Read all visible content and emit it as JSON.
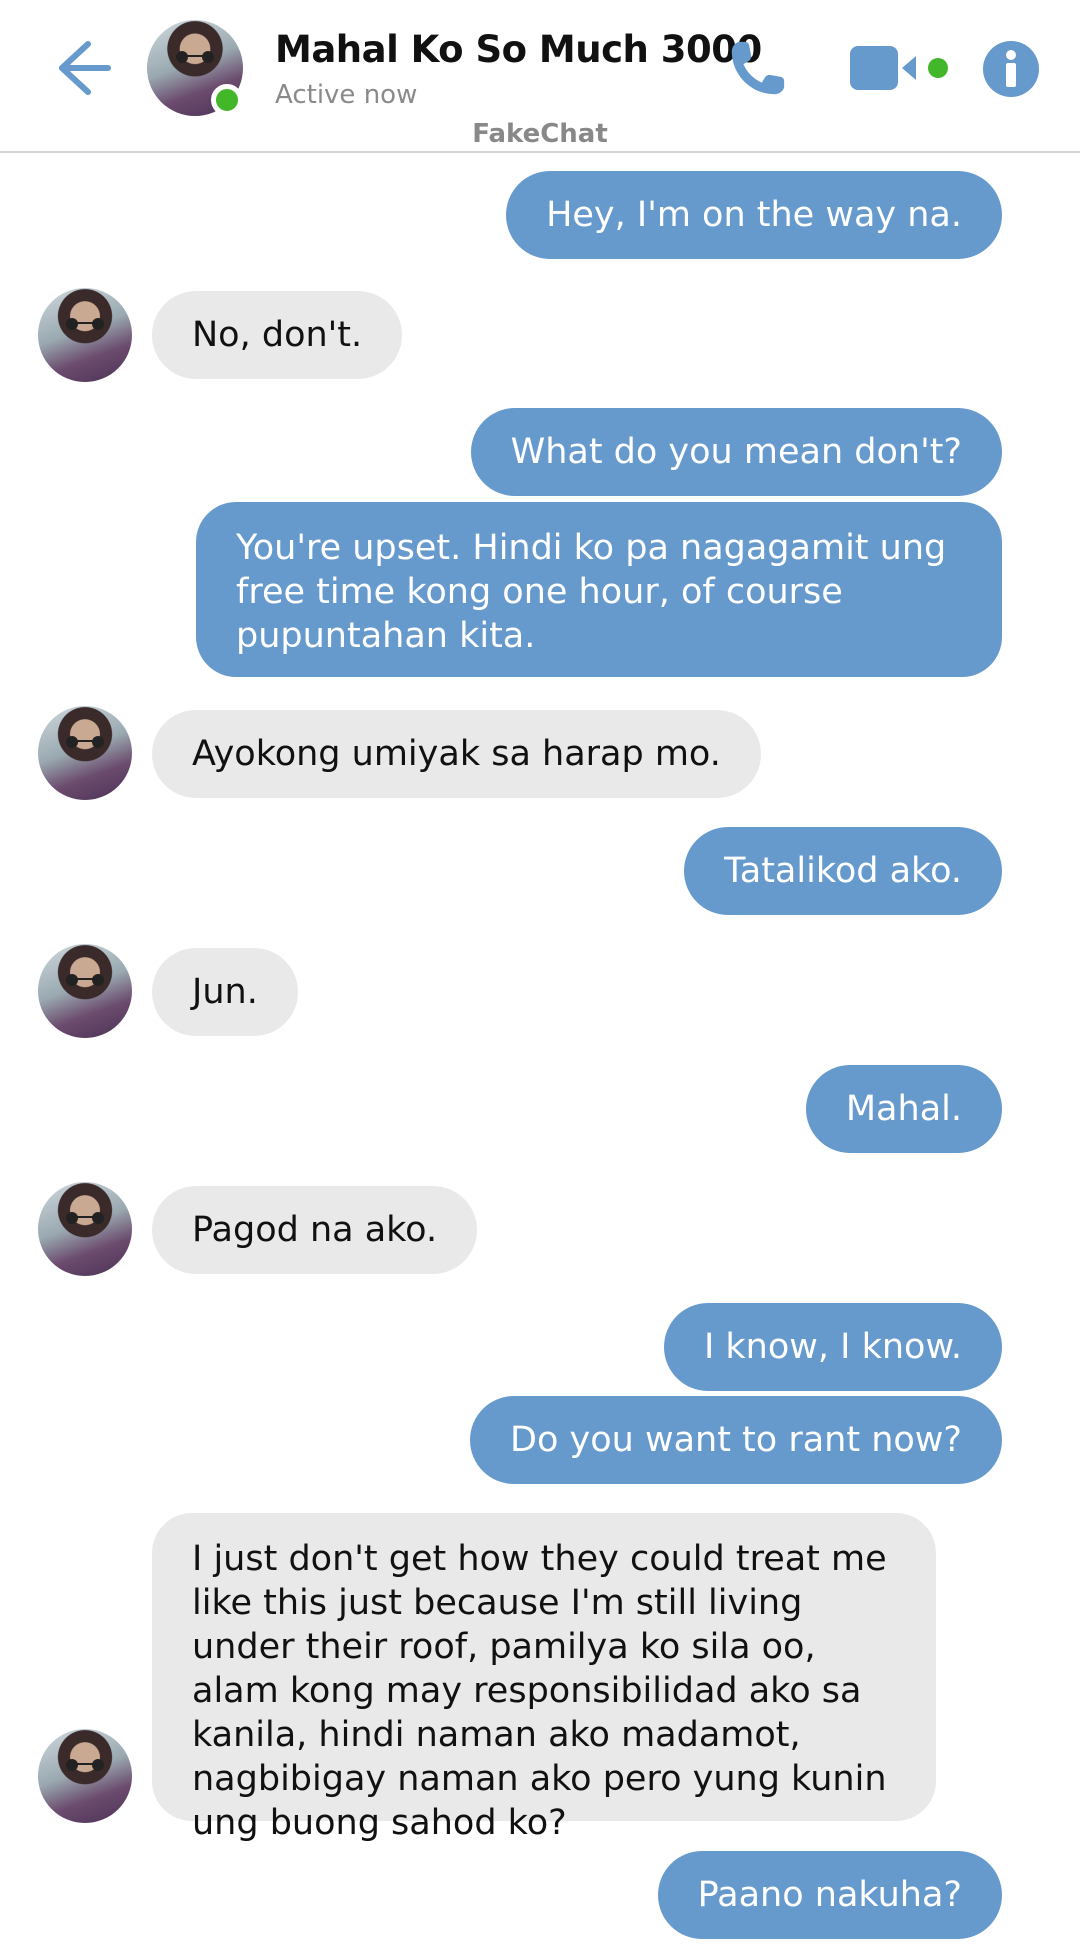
{
  "header": {
    "contact_name": "Mahal Ko So Much 3000",
    "status": "Active now",
    "watermark": "FakeChat",
    "icons": {
      "back": "back-arrow-icon",
      "call": "phone-icon",
      "video": "video-camera-icon",
      "info": "info-icon"
    },
    "colors": {
      "accent": "#6699cc",
      "online": "#42b72a"
    }
  },
  "messages": [
    {
      "from": "me",
      "text": "Hey, I'm on the way na."
    },
    {
      "from": "them",
      "text": "No, don't."
    },
    {
      "from": "me",
      "text": "What do you mean don't?"
    },
    {
      "from": "me",
      "text": "You're upset. Hindi ko pa nagagamit ung free time kong one hour, of course pupuntahan kita."
    },
    {
      "from": "them",
      "text": "Ayokong umiyak sa harap mo."
    },
    {
      "from": "me",
      "text": "Tatalikod ako."
    },
    {
      "from": "them",
      "text": "Jun."
    },
    {
      "from": "me",
      "text": "Mahal."
    },
    {
      "from": "them",
      "text": "Pagod na ako."
    },
    {
      "from": "me",
      "text": "I know, I know."
    },
    {
      "from": "me",
      "text": "Do you want to rant now?"
    },
    {
      "from": "them",
      "text": "I just don't get how they could treat me like this just because I'm still living under their roof, pamilya ko sila oo, alam kong may responsibilidad ako sa kanila, hindi naman ako madamot, nagbibigay naman ako pero yung kunin ung buong sahod ko?"
    },
    {
      "from": "me",
      "text": "Paano nakuha?"
    }
  ]
}
